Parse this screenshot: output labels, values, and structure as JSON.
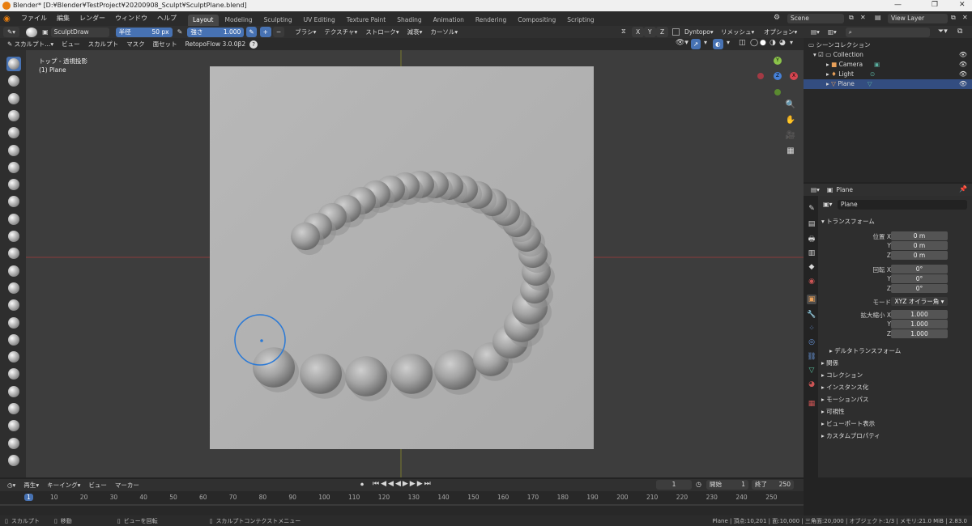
{
  "window": {
    "title": "Blender* [D:¥Blender¥TestProject¥20200908_Sculpt¥SculptPlane.blend]",
    "min": "—",
    "max": "❐",
    "close": "✕"
  },
  "menu": [
    "ファイル",
    "編集",
    "レンダー",
    "ウィンドウ",
    "ヘルプ"
  ],
  "workspaces": [
    "Layout",
    "Modeling",
    "Sculpting",
    "UV Editing",
    "Texture Paint",
    "Shading",
    "Animation",
    "Rendering",
    "Compositing",
    "Scripting"
  ],
  "active_workspace": "Layout",
  "scene": {
    "label": "Scene",
    "view_layer": "View Layer"
  },
  "tool_header": {
    "brush_name": "SculptDraw",
    "radius_label": "半径",
    "radius_value": "50 px",
    "strength_label": "強さ",
    "strength_value": "1.000",
    "plus": "+",
    "minus": "−",
    "brush": "ブラシ",
    "texture": "テクスチャ",
    "stroke": "ストローク",
    "falloff": "減衰",
    "cursor": "カーソル",
    "axes": [
      "X",
      "Y",
      "Z"
    ],
    "dyntopo": "Dyntopo",
    "remesh": "リメッシュ",
    "options": "オプション"
  },
  "mode_header": {
    "mode": "スカルプト...",
    "view": "ビュー",
    "sculpt": "スカルプト",
    "mask": "マスク",
    "face_sets": "面セット",
    "addon": "RetopoFlow 3.0.0β2",
    "help": "?"
  },
  "viewport": {
    "view_name": "トップ - 透視投影",
    "object_name": "(1) Plane"
  },
  "outliner": {
    "search_placeholder": "",
    "items": [
      {
        "label": "シーンコレクション"
      },
      {
        "label": "Collection"
      },
      {
        "label": "Camera"
      },
      {
        "label": "Light"
      },
      {
        "label": "Plane"
      }
    ]
  },
  "properties": {
    "object_name": "Plane",
    "object_field": "Plane",
    "transform": "トランスフォーム",
    "location_label": "位置 X",
    "rotation_label": "回転 X",
    "scale_label": "拡大縮小 X",
    "axis_y": "Y",
    "axis_z": "Z",
    "location": [
      "0 m",
      "0 m",
      "0 m"
    ],
    "rotation": [
      "0°",
      "0°",
      "0°"
    ],
    "mode_label": "モード",
    "mode_value": "XYZ オイラー角",
    "scale": [
      "1.000",
      "1.000",
      "1.000"
    ],
    "sections": [
      "デルタトランスフォーム",
      "関係",
      "コレクション",
      "インスタンス化",
      "モーションパス",
      "可視性",
      "ビューポート表示",
      "カスタムプロパティ"
    ]
  },
  "timeline": {
    "playback": "再生",
    "keying": "キーイング",
    "view": "ビュー",
    "marker": "マーカー",
    "current_frame": "1",
    "start_label": "開始",
    "start": "1",
    "end_label": "終了",
    "end": "250",
    "ticks": [
      "1",
      "10",
      "20",
      "30",
      "40",
      "50",
      "60",
      "70",
      "80",
      "90",
      "100",
      "110",
      "120",
      "130",
      "140",
      "150",
      "160",
      "170",
      "180",
      "190",
      "200",
      "210",
      "220",
      "230",
      "240",
      "250"
    ]
  },
  "status": {
    "left": [
      "スカルプト",
      "移動",
      "ビューを回転",
      "スカルプトコンテクストメニュー"
    ],
    "right": "Plane | 頂点:10,201 | 面:10,000 | 三角面:20,000 | オブジェクト:1/3 | メモリ:21.0 MiB | 2.83.0"
  },
  "colors": {
    "accent": "#4772b3",
    "brush_circle": "#2a79d6",
    "axis_x": "#d64550",
    "axis_y": "#8bc34a",
    "axis_z": "#4680d6"
  }
}
